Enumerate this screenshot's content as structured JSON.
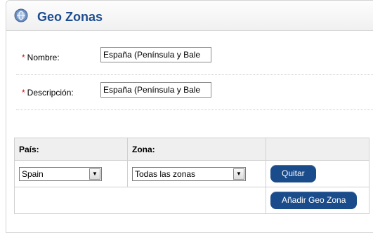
{
  "header": {
    "title": "Geo Zonas",
    "icon": "globe-icon"
  },
  "form": {
    "required_mark": "*",
    "name_label": "Nombre:",
    "name_value": "España (Península y Bale",
    "description_label": "Descripción:",
    "description_value": "España (Península y Bale"
  },
  "table": {
    "headers": {
      "country": "País:",
      "zone": "Zona:"
    },
    "rows": [
      {
        "country": "Spain",
        "zone": "Todas las zonas",
        "action": "Quitar"
      }
    ],
    "add_button": "Añadir Geo Zona"
  },
  "colors": {
    "accent": "#1a4b8a",
    "title": "#1e4d8f",
    "required": "#e00000"
  }
}
